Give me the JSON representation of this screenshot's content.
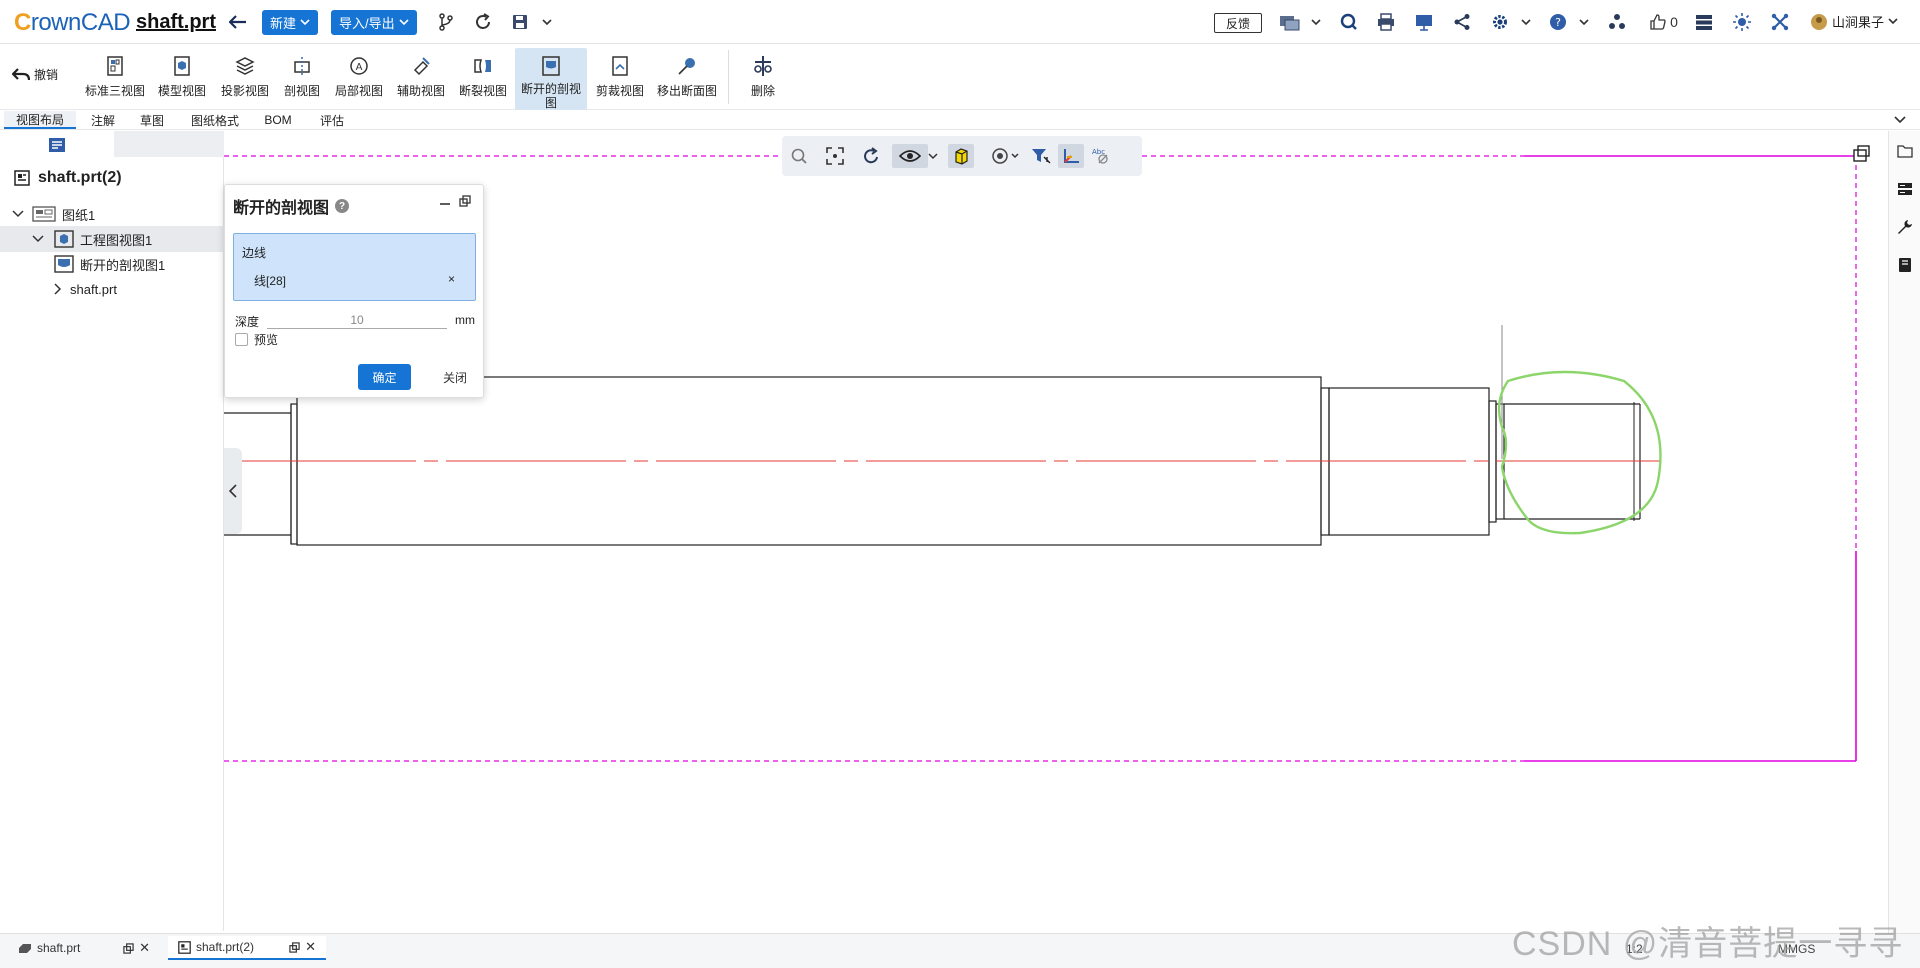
{
  "topbar": {
    "logo_c": "C",
    "logo_rest": "rownCAD",
    "filename": "shaft.prt",
    "new_label": "新建",
    "import_export_label": "导入/导出",
    "feedback_label": "反馈",
    "like_count": "0",
    "user_name": "山涧果子"
  },
  "ribbon": {
    "undo_label": "撤销",
    "tools": [
      {
        "label": "标准三视图"
      },
      {
        "label": "模型视图"
      },
      {
        "label": "投影视图"
      },
      {
        "label": "剖视图"
      },
      {
        "label": "局部视图"
      },
      {
        "label": "辅助视图"
      },
      {
        "label": "断裂视图"
      },
      {
        "label": "断开的剖视图"
      },
      {
        "label": "剪裁视图"
      },
      {
        "label": "移出断面图"
      },
      {
        "label": "删除"
      }
    ]
  },
  "tabs": [
    {
      "label": "视图布局"
    },
    {
      "label": "注解"
    },
    {
      "label": "草图"
    },
    {
      "label": "图纸格式"
    },
    {
      "label": "BOM"
    },
    {
      "label": "评估"
    }
  ],
  "tree": {
    "root": "shaft.prt(2)",
    "items": [
      {
        "label": "图纸1"
      },
      {
        "label": "工程图视图1"
      },
      {
        "label": "断开的剖视图1"
      },
      {
        "label": "shaft.prt"
      }
    ]
  },
  "dialog": {
    "title": "断开的剖视图",
    "help_icon": "?",
    "edge_label": "边线",
    "edge_item": "线[28]",
    "remove_symbol": "×",
    "depth_label": "深度",
    "depth_value": "10",
    "depth_unit": "mm",
    "preview_label": "预览",
    "ok_label": "确定",
    "close_label": "关闭"
  },
  "bottombar": {
    "tabs": [
      {
        "label": "shaft.prt"
      },
      {
        "label": "shaft.prt(2)"
      }
    ],
    "scale": "1:2",
    "units": "MMGS"
  },
  "watermark": "CSDN @清音菩提一寻寻",
  "colors": {
    "accent": "#1574d4",
    "sheet_border": "#e000e0",
    "center_line": "#e53935",
    "sketch_spline": "#8bd56a"
  }
}
